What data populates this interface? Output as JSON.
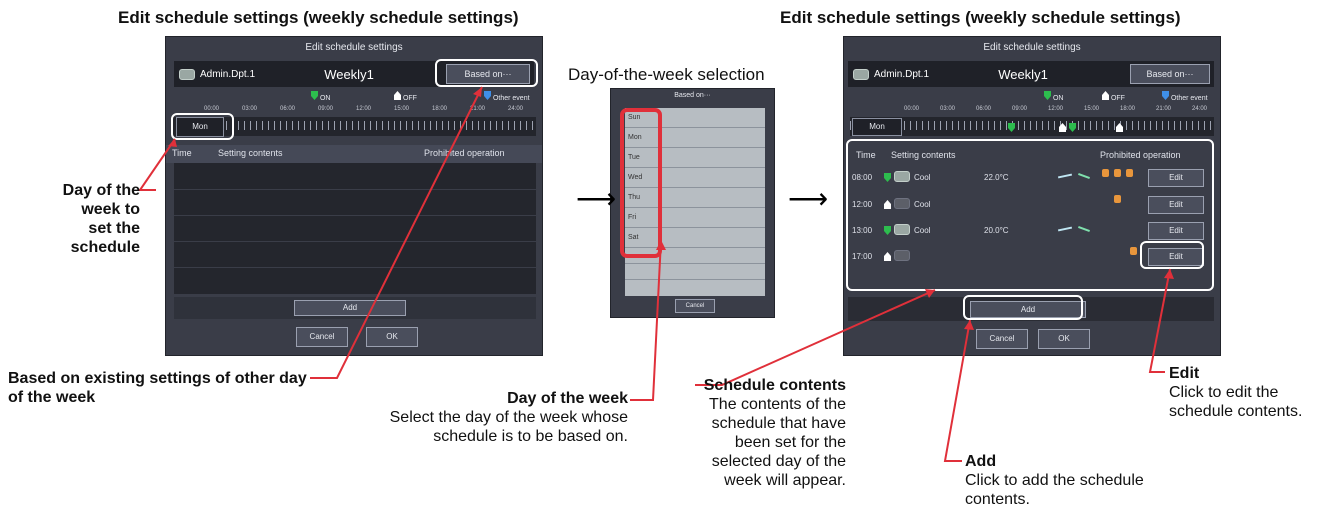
{
  "left_panel": {
    "heading": "Edit schedule settings (weekly schedule settings)",
    "window_title": "Edit schedule settings",
    "group_name": "Admin.Dpt.1",
    "schedule_name": "Weekly1",
    "based_on_button": "Based on···",
    "legend": {
      "on": "ON",
      "off": "OFF",
      "other": "Other event"
    },
    "times": [
      "00:00",
      "03:00",
      "06:00",
      "09:00",
      "12:00",
      "15:00",
      "18:00",
      "21:00",
      "24:00"
    ],
    "day_button": "Mon",
    "columns": {
      "time": "Time",
      "contents": "Setting contents",
      "prohibited": "Prohibited operation"
    },
    "add_button": "Add",
    "cancel_button": "Cancel",
    "ok_button": "OK"
  },
  "middle_panel": {
    "heading": "Day-of-the-week selection",
    "dialog_title": "Based on···",
    "days": [
      "Sun",
      "Mon",
      "Tue",
      "Wed",
      "Thu",
      "Fri",
      "Sat"
    ],
    "cancel_button": "Cancel"
  },
  "right_panel": {
    "heading": "Edit schedule settings (weekly schedule settings)",
    "window_title": "Edit schedule settings",
    "group_name": "Admin.Dpt.1",
    "schedule_name": "Weekly1",
    "based_on_button": "Based on···",
    "legend": {
      "on": "ON",
      "off": "OFF",
      "other": "Other event"
    },
    "times": [
      "00:00",
      "03:00",
      "06:00",
      "09:00",
      "12:00",
      "15:00",
      "18:00",
      "21:00",
      "24:00"
    ],
    "day_button": "Mon",
    "columns": {
      "time": "Time",
      "contents": "Setting contents",
      "prohibited": "Prohibited operation"
    },
    "rows": [
      {
        "time": "08:00",
        "mode": "Cool",
        "temp": "22.0°C",
        "edit": "Edit"
      },
      {
        "time": "12:00",
        "mode": "Cool",
        "temp": "",
        "edit": "Edit"
      },
      {
        "time": "13:00",
        "mode": "Cool",
        "temp": "20.0°C",
        "edit": "Edit"
      },
      {
        "time": "17:00",
        "mode": "",
        "temp": "",
        "edit": "Edit"
      }
    ],
    "add_button": "Add",
    "cancel_button": "Cancel",
    "ok_button": "OK"
  },
  "annotations": {
    "day_of_week_set": "Day of the week to set the schedule",
    "based_on_existing": "Based on existing settings of other day of the week",
    "dow_title": "Day of the week",
    "dow_desc": "Select the day of the week whose schedule is to be based on.",
    "contents_title": "Schedule contents",
    "contents_desc": "The contents of the schedule that have been set for the selected day of the week will appear.",
    "edit_title": "Edit",
    "edit_desc": "Click to edit the schedule contents.",
    "add_title": "Add",
    "add_desc": "Click to add the schedule contents."
  },
  "colors": {
    "highlight_red": "#e0303a",
    "on_green": "#2dbd4e",
    "other_blue": "#3f8fe8"
  }
}
